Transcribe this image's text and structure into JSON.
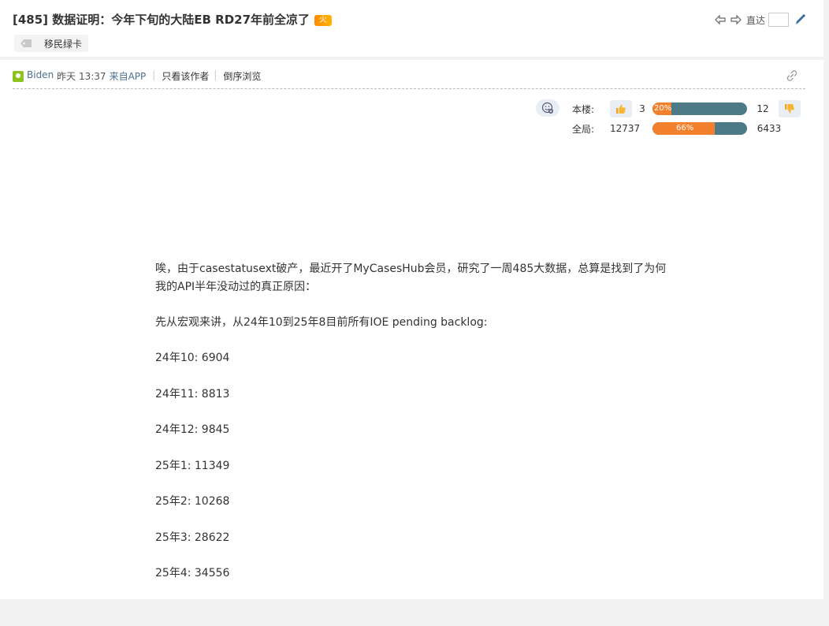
{
  "header": {
    "title": "[485] 数据证明：今年下旬的大陆EB RD27年前全凉了",
    "hot_badge": "火",
    "tag": "移民绿卡",
    "goto_label": "直达"
  },
  "post": {
    "author": "Biden",
    "time": "昨天 13:37",
    "source": "来自APP",
    "only_author": "只看该作者",
    "reverse": "倒序浏览"
  },
  "vote": {
    "floor_label": "本楼:",
    "floor_up": "3",
    "floor_pct_text": "20%",
    "floor_pct": 0.2,
    "floor_down": "12",
    "global_label": "全局:",
    "global_up": "12737",
    "global_pct_text": "66%",
    "global_pct": 0.66,
    "global_down": "6433"
  },
  "content": {
    "intro": "唉，由于casestatusext破产，最近开了MyCasesHub会员，研究了一周485大数据，总算是找到了为何我的API半年没动过的真正原因：",
    "macro": "先从宏观来讲，从24年10到25年8目前所有IOE pending backlog:",
    "lines": [
      "24年10: 6904",
      "24年11: 8813",
      "24年12: 9845",
      "25年1: 11349",
      "25年2: 10268",
      "25年3: 28622",
      "25年4: 34556"
    ]
  },
  "colors": {
    "accent_orange": "#f2802c",
    "bar_teal": "#4d7a87",
    "link_blue": "#4d6f91",
    "avatar_green": "#8dc21f"
  },
  "icons": [
    "tag-icon",
    "prev-arrow-icon",
    "next-arrow-icon",
    "edit-icon",
    "link-icon",
    "emoji-icon",
    "thumbs-up-icon",
    "thumbs-down-icon",
    "avatar-icon"
  ]
}
